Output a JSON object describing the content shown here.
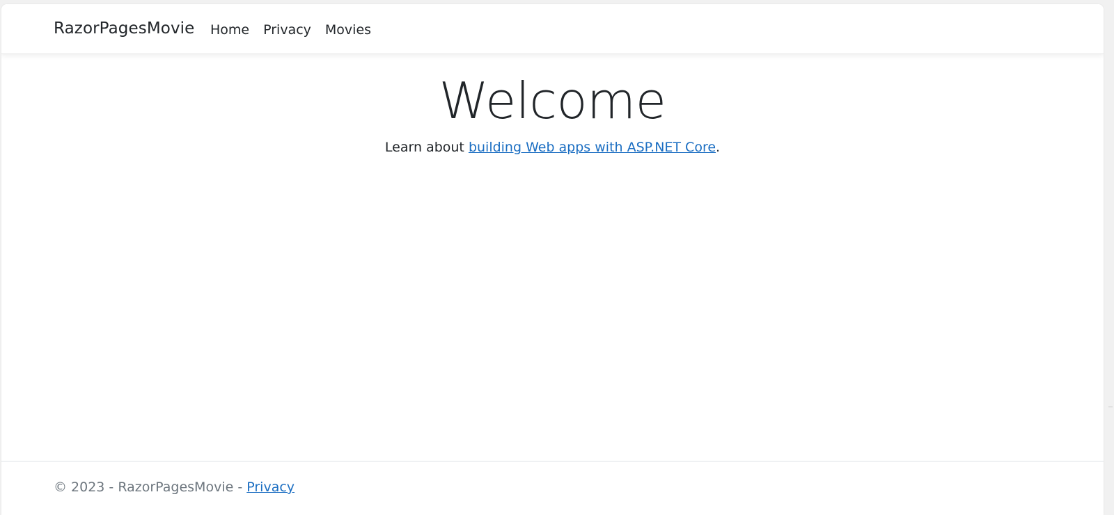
{
  "navbar": {
    "brand": "RazorPagesMovie",
    "links": [
      {
        "label": "Home"
      },
      {
        "label": "Privacy"
      },
      {
        "label": "Movies"
      }
    ]
  },
  "main": {
    "heading": "Welcome",
    "lead_prefix": "Learn about ",
    "lead_link": "building Web apps with ASP.NET Core",
    "lead_suffix": "."
  },
  "footer": {
    "copyright": "© 2023 - RazorPagesMovie - ",
    "privacy_link": "Privacy"
  },
  "colors": {
    "link": "#1b6ec2",
    "text": "#212529",
    "muted": "#6c757d"
  }
}
